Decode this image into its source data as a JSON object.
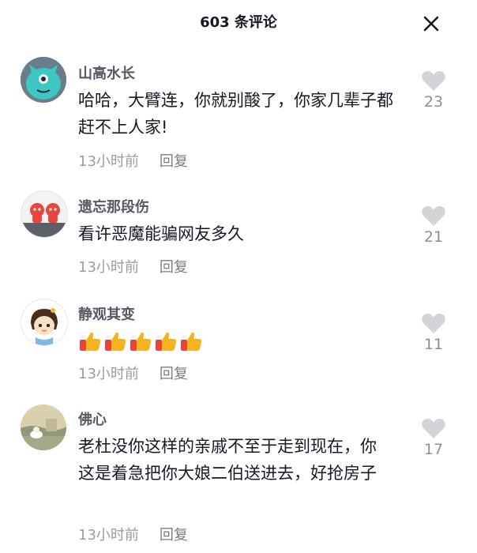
{
  "header": {
    "title": "603 条评论"
  },
  "comments": [
    {
      "name": "山高水长",
      "text": "哈哈，大臂连，你就别酸了，你家几辈子都赶不上人家!",
      "time": "13小时前",
      "reply": "回复",
      "likes": "23",
      "avatar": "teal-monster-avatar"
    },
    {
      "name": "遗忘那段伤",
      "text": "看许恶魔能骗网友多久",
      "time": "13小时前",
      "reply": "回复",
      "likes": "21",
      "avatar": "cartoon-figures-avatar"
    },
    {
      "name": "静观其变",
      "text": "",
      "emoji": [
        "thumbs-up",
        "thumbs-up",
        "thumbs-up",
        "thumbs-up",
        "thumbs-up"
      ],
      "time": "13小时前",
      "reply": "回复",
      "likes": "11",
      "avatar": "cartoon-girl-avatar"
    },
    {
      "name": "佛心",
      "text": "老杜没你这样的亲戚不至于走到现在，你这是着急把你大娘二伯送进去，好抢房子",
      "time": "13小时前",
      "reply": "回复",
      "likes": "17",
      "avatar": "scenery-avatar"
    }
  ],
  "colors": {
    "name": "#555a66",
    "meta": "#9b9ca3",
    "heart": "#d3d4d8",
    "accent": "#f6a623"
  }
}
